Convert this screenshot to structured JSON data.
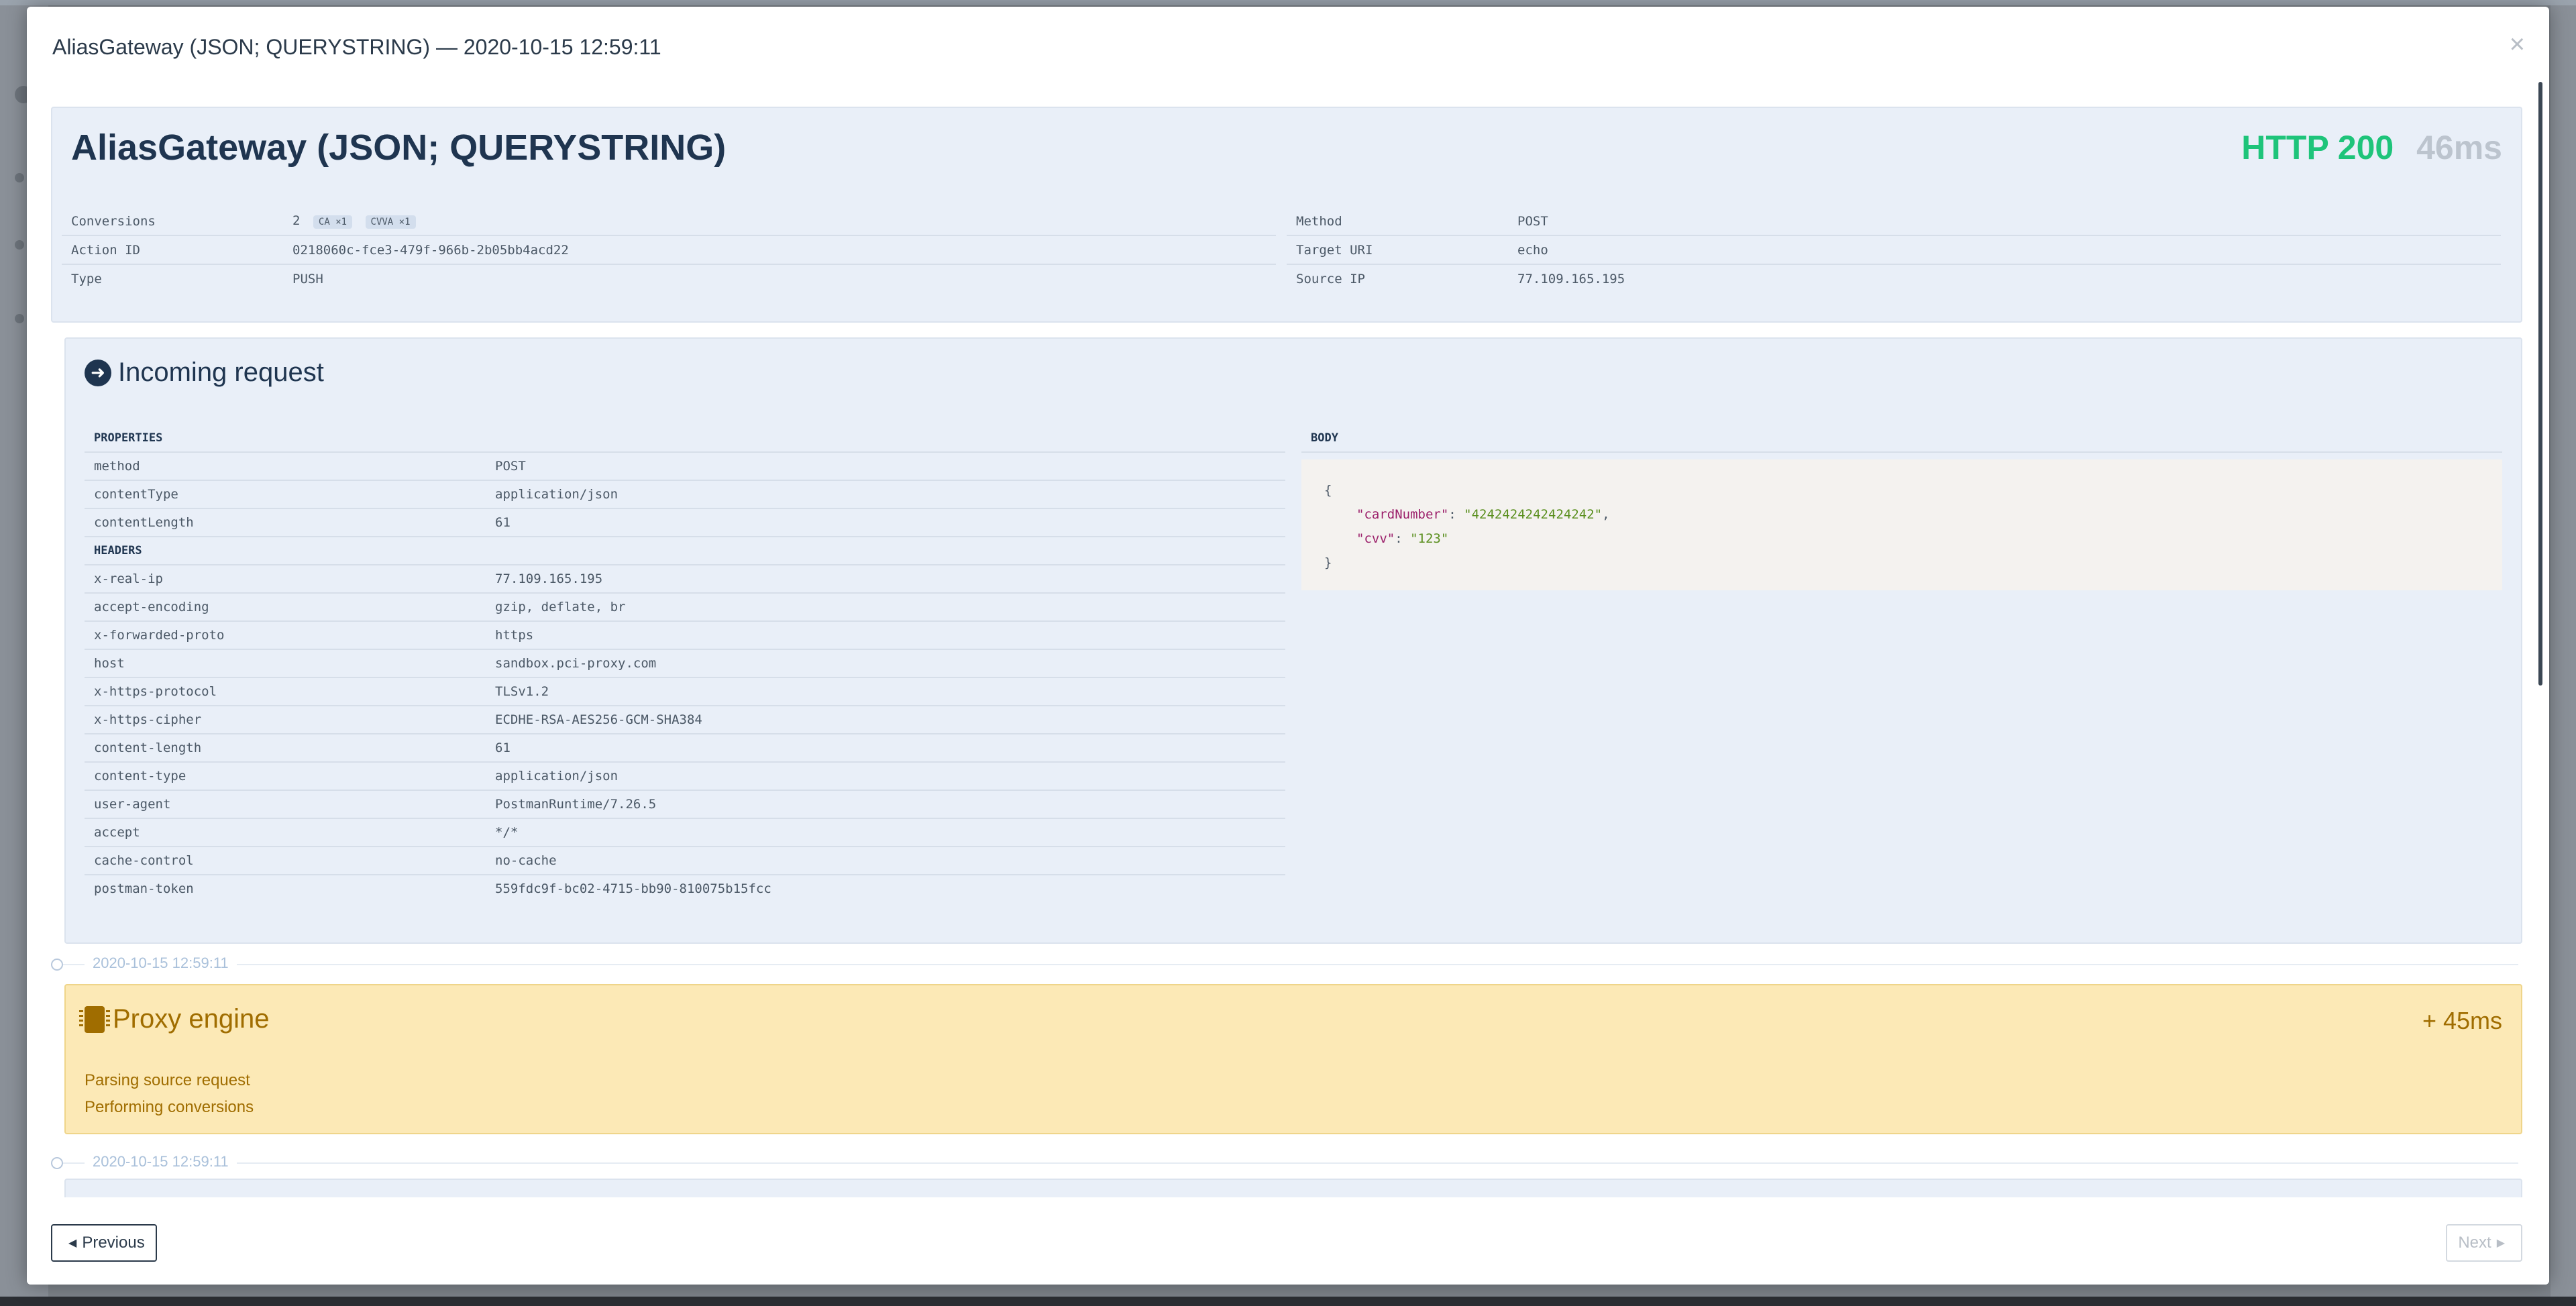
{
  "modal": {
    "title": "AliasGateway (JSON; QUERYSTRING) — 2020-10-15 12:59:11",
    "close_symbol": "×"
  },
  "summary": {
    "heading": "AliasGateway (JSON; QUERYSTRING)",
    "status_code": "HTTP 200",
    "duration": "46ms",
    "left": [
      {
        "key": "Conversions",
        "value": "2",
        "pills": [
          "CA ×1",
          "CVVA ×1"
        ]
      },
      {
        "key": "Action ID",
        "value": "0218060c-fce3-479f-966b-2b05bb4acd22"
      },
      {
        "key": "Type",
        "value": "PUSH"
      }
    ],
    "right": [
      {
        "key": "Method",
        "value": "POST"
      },
      {
        "key": "Target URI",
        "value": "echo"
      },
      {
        "key": "Source IP",
        "value": "77.109.165.195"
      }
    ]
  },
  "incoming": {
    "title": "Incoming request",
    "properties_label": "PROPERTIES",
    "properties": [
      {
        "key": "method",
        "value": "POST"
      },
      {
        "key": "contentType",
        "value": "application/json"
      },
      {
        "key": "contentLength",
        "value": "61"
      }
    ],
    "headers_label": "HEADERS",
    "headers": [
      {
        "key": "x-real-ip",
        "value": "77.109.165.195"
      },
      {
        "key": "accept-encoding",
        "value": "gzip, deflate, br"
      },
      {
        "key": "x-forwarded-proto",
        "value": "https"
      },
      {
        "key": "host",
        "value": "sandbox.pci-proxy.com"
      },
      {
        "key": "x-https-protocol",
        "value": "TLSv1.2"
      },
      {
        "key": "x-https-cipher",
        "value": "ECDHE-RSA-AES256-GCM-SHA384"
      },
      {
        "key": "content-length",
        "value": "61"
      },
      {
        "key": "content-type",
        "value": "application/json"
      },
      {
        "key": "user-agent",
        "value": "PostmanRuntime/7.26.5"
      },
      {
        "key": "accept",
        "value": "*/*"
      },
      {
        "key": "cache-control",
        "value": "no-cache"
      },
      {
        "key": "postman-token",
        "value": "559fdc9f-bc02-4715-bb90-810075b15fcc"
      }
    ],
    "body_label": "BODY",
    "body": {
      "open": "{",
      "card_key": "\"cardNumber\"",
      "card_val": "\"4242424242424242\"",
      "cvv_key": "\"cvv\"",
      "cvv_val": "\"123\"",
      "close": "}"
    }
  },
  "timeline": {
    "ts1": "2020-10-15 12:59:11",
    "ts2": "2020-10-15 12:59:11"
  },
  "proxy": {
    "title": "Proxy engine",
    "delta": "+ 45ms",
    "line1": "Parsing source request",
    "line2": "Performing conversions"
  },
  "footer": {
    "prev_label": "Previous",
    "next_label": "Next"
  }
}
